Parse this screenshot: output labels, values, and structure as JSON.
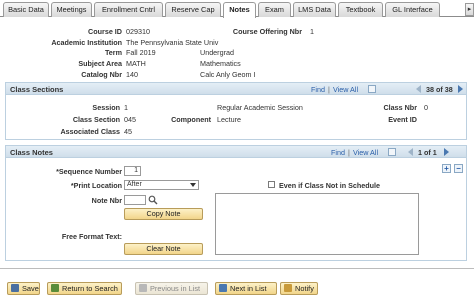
{
  "tabs": [
    "Basic Data",
    "Meetings",
    "Enrollment Cntrl",
    "Reserve Cap",
    "Notes",
    "Exam",
    "LMS Data",
    "Textbook",
    "GL Interface"
  ],
  "active_tab": "Notes",
  "header": {
    "course_id_label": "Course ID",
    "course_id": "029310",
    "offering_label": "Course Offering Nbr",
    "offering": "1",
    "institution_label": "Academic Institution",
    "institution": "The Pennsylvania State Univ",
    "term_label": "Term",
    "term": "Fall 2019",
    "career": "Undergrad",
    "subject_label": "Subject Area",
    "subject": "MATH",
    "subject_desc": "Mathematics",
    "catalog_label": "Catalog Nbr",
    "catalog": "140",
    "catalog_desc": "Calc Anly Geom I"
  },
  "class_sections": {
    "title": "Class Sections",
    "find": "Find",
    "view_all": "View All",
    "pipe": "|",
    "count": "38 of 38",
    "session_label": "Session",
    "session": "1",
    "session_desc": "Regular Academic Session",
    "class_nbr_label": "Class Nbr",
    "class_nbr": "0",
    "class_section_label": "Class Section",
    "class_section": "045",
    "component_label": "Component",
    "component": "Lecture",
    "event_id_label": "Event ID",
    "assoc_label": "Associated Class",
    "assoc": "45"
  },
  "class_notes": {
    "title": "Class Notes",
    "find": "Find",
    "view_all": "View All",
    "pipe": "|",
    "count": "1 of 1",
    "seq_label": "*Sequence Number",
    "seq": "1",
    "print_label": "*Print Location",
    "print_value": "After",
    "even_label": "Even if Class Not in Schedule",
    "note_nbr_label": "Note Nbr",
    "copy_note": "Copy Note",
    "free_text_label": "Free Format Text:",
    "clear_note": "Clear Note",
    "plus": "+",
    "minus": "−"
  },
  "footer": {
    "save": "Save",
    "return": "Return to Search",
    "prev": "Previous in List",
    "next": "Next in List",
    "notify": "Notify"
  }
}
